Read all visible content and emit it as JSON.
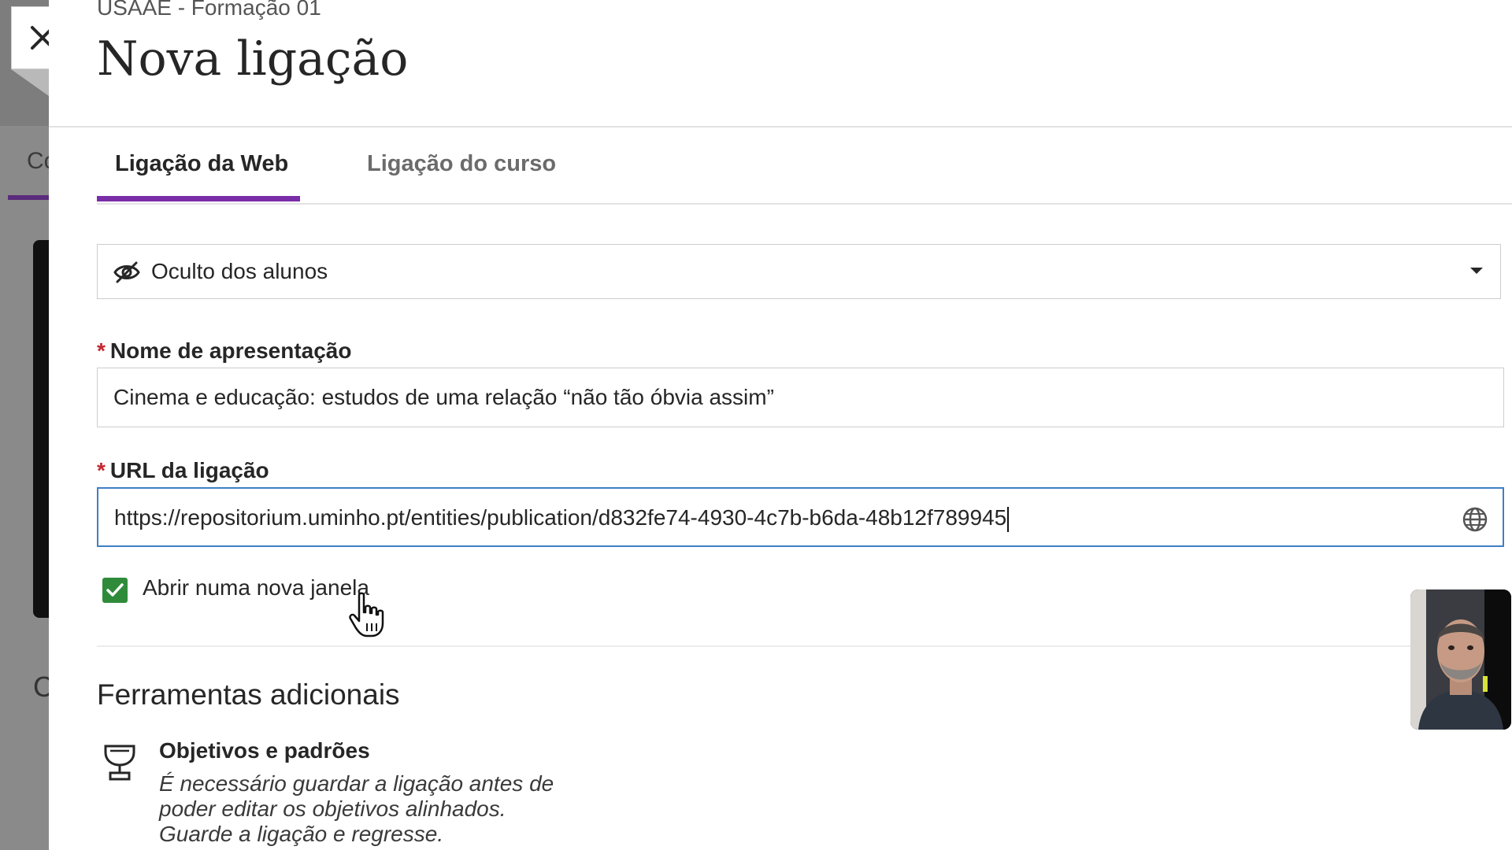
{
  "background": {
    "tab_fragment": "Co",
    "letter_fragment": "C"
  },
  "dialog": {
    "course_name": "USAAE - Formação 01",
    "title": "Nova ligação",
    "tabs": [
      {
        "label": "Ligação da Web",
        "active": true
      },
      {
        "label": "Ligação do curso",
        "active": false
      }
    ],
    "visibility": {
      "selected": "Oculto dos alunos",
      "icon": "eye-slash-icon"
    },
    "display_name": {
      "label": "Nome de apresentação",
      "required_mark": "*",
      "value": "Cinema e educação: estudos de uma relação “não tão óbvia assim”"
    },
    "url": {
      "label": "URL da ligação",
      "required_mark": "*",
      "value": "https://repositorium.uminho.pt/entities/publication/d832fe74-4930-4c7b-b6da-48b12f789945",
      "icon": "globe-icon"
    },
    "open_new_window": {
      "label": "Abrir numa nova janela",
      "checked": true
    },
    "additional_tools": {
      "title": "Ferramentas adicionais",
      "goals": {
        "title": "Objetivos e padrões",
        "description_lines": [
          "É necessário guardar a ligação antes de",
          "poder editar os objetivos alinhados.",
          "Guarde a ligação e regresse."
        ]
      }
    }
  },
  "colors": {
    "accent_purple": "#7a2da8",
    "checkbox_green": "#2f8b3a",
    "focus_blue": "#3e7fc6",
    "required_red": "#c4262e"
  }
}
